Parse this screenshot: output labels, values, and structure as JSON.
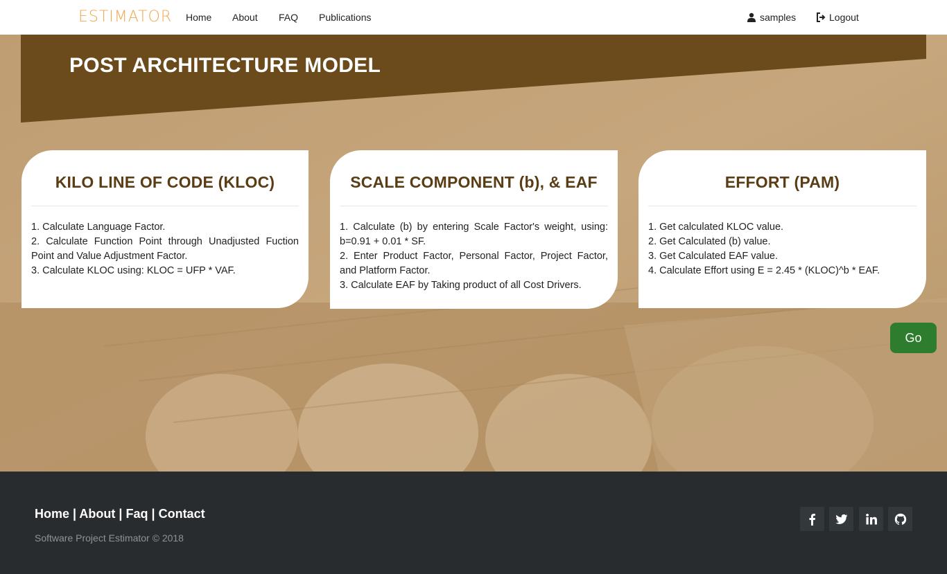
{
  "navbar": {
    "brand": "ESTIMATOR",
    "links": [
      "Home",
      "About",
      "FAQ",
      "Publications"
    ],
    "user": "samples",
    "logout": "Logout"
  },
  "banner": {
    "title": "POST ARCHITECTURE MODEL"
  },
  "cards": [
    {
      "title": "KILO LINE OF CODE (KLOC)",
      "lines": [
        "1. Calculate Language Factor.",
        "2. Calculate Function Point through Unadjusted Fuction Point and Value Adjustment Factor.",
        "3. Calculate KLOC using: KLOC = UFP * VAF."
      ]
    },
    {
      "title": "SCALE COMPONENT (b), & EAF",
      "lines": [
        "1. Calculate (b) by entering Scale Factor's weight, using: b=0.91 + 0.01 * SF.",
        "2. Enter Product Factor, Personal Factor, Project Factor, and Platform Factor.",
        "3. Calculate EAF by Taking product of all Cost Drivers."
      ]
    },
    {
      "title": "EFFORT (PAM)",
      "lines": [
        "1. Get calculated KLOC value.",
        "2. Get Calculated (b) value.",
        "3. Get Calculated EAF value.",
        "4. Calculate Effort using E = 2.45 * (KLOC)^b * EAF."
      ]
    }
  ],
  "go_button": "Go",
  "footer": {
    "links": [
      "Home",
      "About",
      "Faq",
      "Contact"
    ],
    "separator": "|",
    "copyright": "Software Project Estimator © 2018",
    "social": [
      "facebook-icon",
      "twitter-icon",
      "linkedin-icon",
      "github-icon"
    ]
  },
  "colors": {
    "brand": "#f0a64f",
    "banner": "#6b4a1c",
    "card_title": "#5a3d14",
    "go_button": "#2e7d2e",
    "footer": "#292c2f"
  }
}
